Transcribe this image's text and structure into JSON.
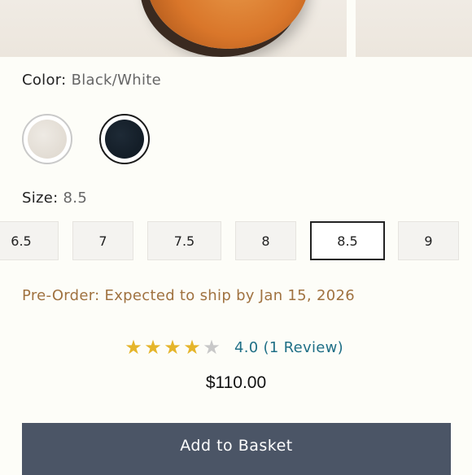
{
  "product": {
    "color_label": "Color:",
    "color_value": "Black/White",
    "size_label": "Size:",
    "size_value": "8.5",
    "sizes": [
      "6.5",
      "7",
      "7.5",
      "8",
      "8.5",
      "9"
    ],
    "selected_size": "8.5",
    "preorder_text": "Pre-Order: Expected to ship by Jan 15, 2026",
    "rating": 4,
    "rating_max": 5,
    "rating_text": "4.0 (1 Review)",
    "price": "$110.00",
    "add_button": "Add to Basket"
  },
  "swatches": [
    {
      "name": "light",
      "color": "#e6e1d9"
    },
    {
      "name": "dark",
      "color": "#15202b"
    }
  ],
  "colors": {
    "accent_button": "#4b5566",
    "preorder": "#a07240",
    "link": "#1f6f86",
    "star": "#e5b52b"
  },
  "icons": [
    "star-icon"
  ]
}
